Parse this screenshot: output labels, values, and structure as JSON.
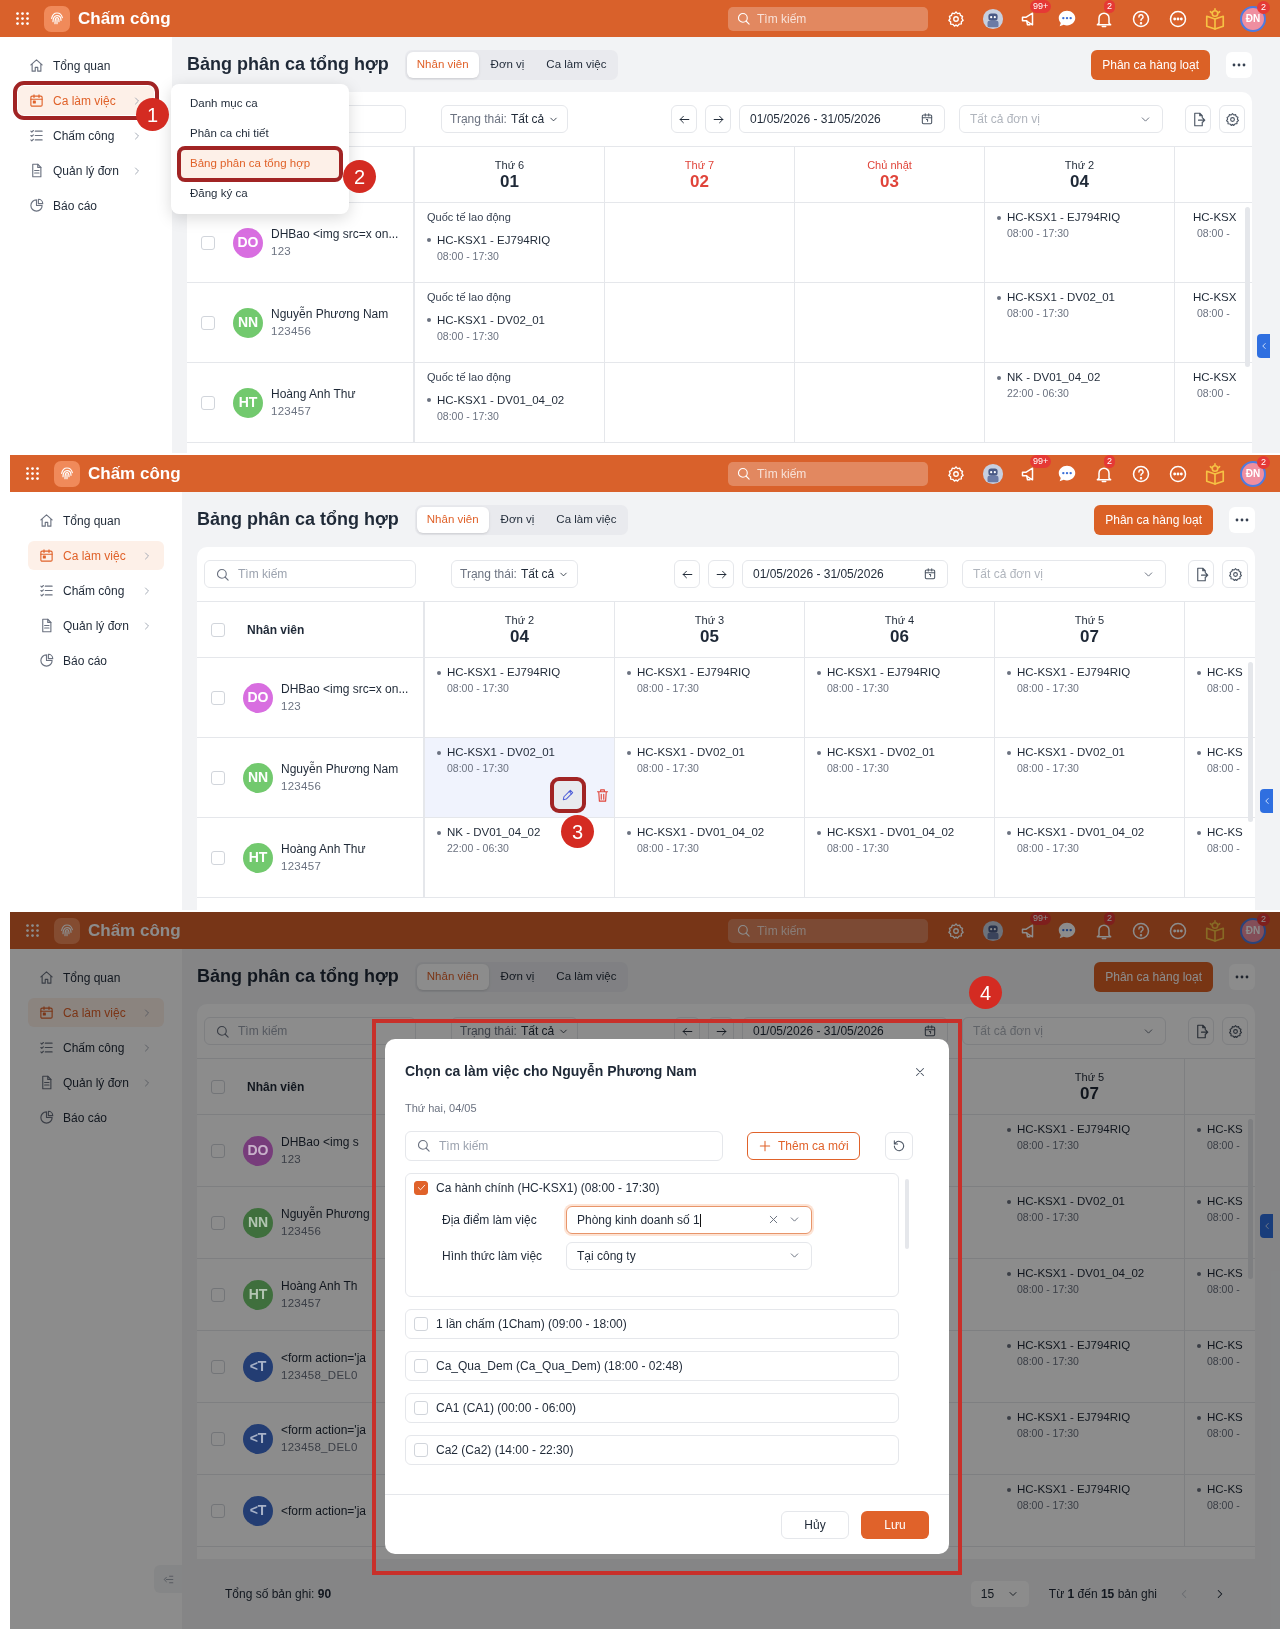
{
  "panels": [
    {
      "dimmed": false,
      "topbar": {
        "app_name": "Chấm công",
        "search_placeholder": "Tìm kiếm",
        "icons": [
          {
            "kind": "settings"
          },
          {
            "kind": "bot-avatar"
          },
          {
            "kind": "megaphone",
            "badge": "99+"
          },
          {
            "kind": "chat"
          },
          {
            "kind": "bell",
            "badge": "2"
          },
          {
            "kind": "help"
          },
          {
            "kind": "more"
          },
          {
            "kind": "idea"
          }
        ],
        "user": {
          "initials": "ĐN",
          "badge": "2"
        }
      },
      "sidebar": [
        {
          "label": "Tổng quan",
          "kind": "home",
          "selected": false,
          "submenu": false
        },
        {
          "label": "Ca làm việc",
          "kind": "calendar",
          "selected": true,
          "submenu": true,
          "callout": "1"
        },
        {
          "label": "Chấm công",
          "kind": "checklist",
          "selected": false,
          "submenu": true
        },
        {
          "label": "Quản lý đơn",
          "kind": "document",
          "selected": false,
          "submenu": true
        },
        {
          "label": "Báo cáo",
          "kind": "report",
          "selected": false,
          "submenu": false
        }
      ],
      "title": "Bảng phân ca tổng hợp",
      "tabs": [
        {
          "label": "Nhân viên",
          "selected": true
        },
        {
          "label": "Đơn vị",
          "selected": false
        },
        {
          "label": "Ca làm việc",
          "selected": false
        }
      ],
      "bulk_button": "Phân ca hàng loạt",
      "filters": {
        "status_label": "Trạng thái:",
        "status_value": "Tất cả",
        "date_range": "01/05/2026 - 31/05/2026",
        "unit_placeholder": "Tất cả đơn vị"
      },
      "grid": {
        "days": [
          {
            "weekday": "Thứ 6",
            "day": "01",
            "weekend": false
          },
          {
            "weekday": "Thứ 7",
            "day": "02",
            "weekend": true
          },
          {
            "weekday": "Chủ nhật",
            "day": "03",
            "weekend": true
          },
          {
            "weekday": "Thứ 2",
            "day": "04",
            "weekend": false
          }
        ],
        "rows": [
          {
            "initials": "DO",
            "color": "#d86ee0",
            "name": "DHBao <img src=x on...",
            "code": "123",
            "checked": false,
            "cells": [
              {
                "holiday": "Quốc tế lao động",
                "shifts": [
                  {
                    "name": "HC-KSX1 - EJ794RIQ",
                    "time": "08:00 - 17:30"
                  }
                ]
              },
              {},
              {},
              {
                "shifts": [
                  {
                    "name": "HC-KSX1 - EJ794RIQ",
                    "time": "08:00 - 17:30"
                  }
                ]
              },
              {
                "shifts": [
                  {
                    "name": "HC-KSX",
                    "time": "08:00 -"
                  }
                ]
              }
            ]
          },
          {
            "initials": "NN",
            "color": "#72c96e",
            "name": "Nguyễn Phương Nam",
            "code": "123456",
            "checked": false,
            "cells": [
              {
                "holiday": "Quốc tế lao động",
                "shifts": [
                  {
                    "name": "HC-KSX1 - DV02_01",
                    "time": "08:00 - 17:30"
                  }
                ]
              },
              {},
              {},
              {
                "shifts": [
                  {
                    "name": "HC-KSX1 - DV02_01",
                    "time": "08:00 - 17:30"
                  }
                ]
              },
              {
                "shifts": [
                  {
                    "name": "HC-KSX",
                    "time": "08:00 -"
                  }
                ]
              }
            ]
          },
          {
            "initials": "HT",
            "color": "#72c96e",
            "name": "Hoàng Anh Thư",
            "code": "123457",
            "checked": false,
            "cells": [
              {
                "holiday": "Quốc tế lao động",
                "shifts": [
                  {
                    "name": "HC-KSX1 - DV01_04_02",
                    "time": "08:00 - 17:30"
                  }
                ]
              },
              {},
              {},
              {
                "shifts": [
                  {
                    "name": "NK - DV01_04_02",
                    "time": "22:00 - 06:30"
                  }
                ]
              },
              {
                "shifts": [
                  {
                    "name": "HC-KSX",
                    "time": "08:00 -"
                  }
                ]
              }
            ]
          }
        ]
      },
      "menu": [
        {
          "label": "Danh mục ca",
          "selected": false
        },
        {
          "label": "Phân ca chi tiết",
          "selected": false
        },
        {
          "label": "Bảng phân ca tổng hợp",
          "selected": true,
          "callout": "2"
        },
        {
          "label": "Đăng ký ca",
          "selected": false
        }
      ]
    },
    {
      "dimmed": false,
      "topbar": {
        "app_name": "Chấm công",
        "search_placeholder": "Tìm kiếm",
        "icons": [
          {
            "kind": "settings"
          },
          {
            "kind": "bot-avatar"
          },
          {
            "kind": "megaphone",
            "badge": "99+"
          },
          {
            "kind": "chat"
          },
          {
            "kind": "bell",
            "badge": "2"
          },
          {
            "kind": "help"
          },
          {
            "kind": "more"
          },
          {
            "kind": "idea"
          }
        ],
        "user": {
          "initials": "ĐN",
          "badge": "2"
        }
      },
      "sidebar": [
        {
          "label": "Tổng quan",
          "kind": "home",
          "selected": false,
          "submenu": false
        },
        {
          "label": "Ca làm việc",
          "kind": "calendar",
          "selected": true,
          "submenu": true
        },
        {
          "label": "Chấm công",
          "kind": "checklist",
          "selected": false,
          "submenu": true
        },
        {
          "label": "Quản lý đơn",
          "kind": "document",
          "selected": false,
          "submenu": true
        },
        {
          "label": "Báo cáo",
          "kind": "report",
          "selected": false,
          "submenu": false
        }
      ],
      "title": "Bảng phân ca tổng hợp",
      "tabs": [
        {
          "label": "Nhân viên",
          "selected": true
        },
        {
          "label": "Đơn vị",
          "selected": false
        },
        {
          "label": "Ca làm việc",
          "selected": false
        }
      ],
      "bulk_button": "Phân ca hàng loạt",
      "filters": {
        "search_placeholder": "Tìm kiếm",
        "status_label": "Trạng thái:",
        "status_value": "Tất cả",
        "date_range": "01/05/2026 - 31/05/2026",
        "unit_placeholder": "Tất cả đơn vị"
      },
      "grid": {
        "employee_header": "Nhân viên",
        "all_checked": false,
        "days": [
          {
            "weekday": "Thứ 2",
            "day": "04",
            "weekend": false
          },
          {
            "weekday": "Thứ 3",
            "day": "05",
            "weekend": false
          },
          {
            "weekday": "Thứ 4",
            "day": "06",
            "weekend": false
          },
          {
            "weekday": "Thứ 5",
            "day": "07",
            "weekend": false
          }
        ],
        "rows": [
          {
            "initials": "DO",
            "color": "#d86ee0",
            "name": "DHBao <img src=x on...",
            "code": "123",
            "checked": false,
            "cells": [
              {
                "shifts": [
                  {
                    "name": "HC-KSX1 - EJ794RIQ",
                    "time": "08:00 - 17:30"
                  }
                ]
              },
              {
                "shifts": [
                  {
                    "name": "HC-KSX1 - EJ794RIQ",
                    "time": "08:00 - 17:30"
                  }
                ]
              },
              {
                "shifts": [
                  {
                    "name": "HC-KSX1 - EJ794RIQ",
                    "time": "08:00 - 17:30"
                  }
                ]
              },
              {
                "shifts": [
                  {
                    "name": "HC-KSX1 - EJ794RIQ",
                    "time": "08:00 - 17:30"
                  }
                ]
              },
              {
                "shifts": [
                  {
                    "name": "HC-KS",
                    "time": "08:00 -"
                  }
                ]
              }
            ]
          },
          {
            "initials": "NN",
            "color": "#72c96e",
            "name": "Nguyễn Phương Nam",
            "code": "123456",
            "checked": false,
            "cells": [
              {
                "hovered": true,
                "callout": "3",
                "shifts": [
                  {
                    "name": "HC-KSX1 - DV02_01",
                    "time": "08:00 - 17:30"
                  }
                ]
              },
              {
                "shifts": [
                  {
                    "name": "HC-KSX1 - DV02_01",
                    "time": "08:00 - 17:30"
                  }
                ]
              },
              {
                "shifts": [
                  {
                    "name": "HC-KSX1 - DV02_01",
                    "time": "08:00 - 17:30"
                  }
                ]
              },
              {
                "shifts": [
                  {
                    "name": "HC-KSX1 - DV02_01",
                    "time": "08:00 - 17:30"
                  }
                ]
              },
              {
                "shifts": [
                  {
                    "name": "HC-KS",
                    "time": "08:00 -"
                  }
                ]
              }
            ]
          },
          {
            "initials": "HT",
            "color": "#72c96e",
            "name": "Hoàng Anh Thư",
            "code": "123457",
            "checked": false,
            "cells": [
              {
                "shifts": [
                  {
                    "name": "NK - DV01_04_02",
                    "time": "22:00 - 06:30"
                  }
                ]
              },
              {
                "shifts": [
                  {
                    "name": "HC-KSX1 - DV01_04_02",
                    "time": "08:00 - 17:30"
                  }
                ]
              },
              {
                "shifts": [
                  {
                    "name": "HC-KSX1 - DV01_04_02",
                    "time": "08:00 - 17:30"
                  }
                ]
              },
              {
                "shifts": [
                  {
                    "name": "HC-KSX1 - DV01_04_02",
                    "time": "08:00 - 17:30"
                  }
                ]
              },
              {
                "shifts": [
                  {
                    "name": "HC-KS",
                    "time": "08:00 -"
                  }
                ]
              }
            ]
          }
        ]
      }
    },
    {
      "dimmed": true,
      "topbar": {
        "app_name": "Chấm công",
        "search_placeholder": "Tìm kiếm",
        "icons": [
          {
            "kind": "settings"
          },
          {
            "kind": "bot-avatar"
          },
          {
            "kind": "megaphone",
            "badge": "99+"
          },
          {
            "kind": "chat"
          },
          {
            "kind": "bell",
            "badge": "2"
          },
          {
            "kind": "help"
          },
          {
            "kind": "more"
          },
          {
            "kind": "idea"
          }
        ],
        "user": {
          "initials": "ĐN",
          "badge": "2"
        }
      },
      "sidebar": [
        {
          "label": "Tổng quan",
          "kind": "home",
          "selected": false,
          "submenu": false
        },
        {
          "label": "Ca làm việc",
          "kind": "calendar",
          "selected": true,
          "submenu": true
        },
        {
          "label": "Chấm công",
          "kind": "checklist",
          "selected": false,
          "submenu": true
        },
        {
          "label": "Quản lý đơn",
          "kind": "document",
          "selected": false,
          "submenu": true
        },
        {
          "label": "Báo cáo",
          "kind": "report",
          "selected": false,
          "submenu": false
        }
      ],
      "title": "Bảng phân ca tổng hợp",
      "tabs": [
        {
          "label": "Nhân viên",
          "selected": true
        },
        {
          "label": "Đơn vị",
          "selected": false
        },
        {
          "label": "Ca làm việc",
          "selected": false
        }
      ],
      "bulk_button": "Phân ca hàng loạt",
      "filters": {
        "search_placeholder": "Tìm kiếm",
        "status_label": "Trạng thái:",
        "status_value": "Tất cả",
        "date_range": "01/05/2026 - 31/05/2026",
        "unit_placeholder": "Tất cả đơn vị"
      },
      "grid": {
        "employee_header": "Nhân viên",
        "all_checked": false,
        "days": [
          {
            "weekday": "Thứ 5",
            "day": "07",
            "weekend": false
          }
        ],
        "rows": [
          {
            "initials": "DO",
            "color": "#773c7b",
            "name": "DHBao <img s",
            "code": "123",
            "checked": false,
            "cells": [
              {
                "shifts": [
                  {
                    "name": "HC-KSX1 - EJ794RIQ",
                    "time": "08:00 - 17:30"
                  }
                ]
              },
              {
                "shifts": [
                  {
                    "name": "HC-KS",
                    "time": "08:00 -"
                  }
                ]
              }
            ]
          },
          {
            "initials": "NN",
            "color": "#3f6f3d",
            "name": "Nguyễn Phương",
            "code": "123456",
            "checked": false,
            "cells": [
              {
                "shifts": [
                  {
                    "name": "HC-KSX1 - DV02_01",
                    "time": "08:00 - 17:30"
                  }
                ]
              },
              {
                "shifts": [
                  {
                    "name": "HC-KS",
                    "time": "08:00 -"
                  }
                ]
              }
            ]
          },
          {
            "initials": "HT",
            "color": "#3f6f3d",
            "name": "Hoàng Anh Th",
            "code": "123457",
            "checked": false,
            "cells": [
              {
                "shifts": [
                  {
                    "name": "HC-KSX1 - DV01_04_02",
                    "time": "08:00 - 17:30"
                  }
                ]
              },
              {
                "shifts": [
                  {
                    "name": "HC-KS",
                    "time": "08:00 -"
                  }
                ]
              }
            ]
          },
          {
            "initials": "<T",
            "color": "#233d73",
            "name": "<form action='ja",
            "code": "123458_DEL0",
            "checked": false,
            "cells": [
              {
                "shifts": [
                  {
                    "name": "HC-KSX1 - EJ794RIQ",
                    "time": "08:00 - 17:30"
                  }
                ]
              },
              {
                "shifts": [
                  {
                    "name": "HC-KS",
                    "time": "08:00 -"
                  }
                ]
              }
            ]
          },
          {
            "initials": "<T",
            "color": "#233d73",
            "name": "<form action='ja",
            "code": "123458_DEL0",
            "checked": false,
            "cells": [
              {
                "shifts": [
                  {
                    "name": "HC-KSX1 - EJ794RIQ",
                    "time": "08:00 - 17:30"
                  }
                ]
              },
              {
                "shifts": [
                  {
                    "name": "HC-KS",
                    "time": "08:00 -"
                  }
                ]
              }
            ]
          },
          {
            "initials": "<T",
            "color": "#233d73",
            "name": "<form action='ja",
            "checked": false,
            "cells": [
              {
                "shifts": [
                  {
                    "name": "HC-KSX1 - EJ794RIQ",
                    "time": "08:00 - 17:30"
                  }
                ]
              },
              {
                "shifts": [
                  {
                    "name": "HC-KS",
                    "time": "08:00 -"
                  }
                ]
              }
            ]
          }
        ]
      },
      "footer": {
        "total": "Tổng số bản ghi: **90**",
        "page_size": "15",
        "range": "Từ **1** đến **15** bản ghi"
      },
      "modal": {
        "title": "Chọn ca làm việc cho Nguyễn Phương Nam",
        "subtitle": "Thứ hai, 04/05",
        "search_placeholder": "Tìm kiếm",
        "add_button": "Thêm ca mới",
        "callout": "4",
        "shifts": [
          {
            "label": "Ca hành chính (HC-KSX1) (08:00 - 17:30)",
            "checked": true,
            "fields": [
              {
                "label": "Địa điểm làm việc",
                "value": "Phòng kinh doanh số 1",
                "focused": true
              },
              {
                "label": "Hình thức làm việc",
                "value": "Tại công ty",
                "focused": false
              }
            ]
          },
          {
            "label": "1 lần chấm (1Cham) (09:00 - 18:00)",
            "checked": false
          },
          {
            "label": "Ca_Qua_Dem (Ca_Qua_Dem) (18:00 - 02:48)",
            "checked": false
          },
          {
            "label": "CA1 (CA1) (00:00 - 06:00)",
            "checked": false
          },
          {
            "label": "Ca2 (Ca2) (14:00 - 22:30)",
            "checked": false
          }
        ],
        "buttons": {
          "cancel": "Hủy",
          "save": "Lưu"
        }
      }
    }
  ]
}
